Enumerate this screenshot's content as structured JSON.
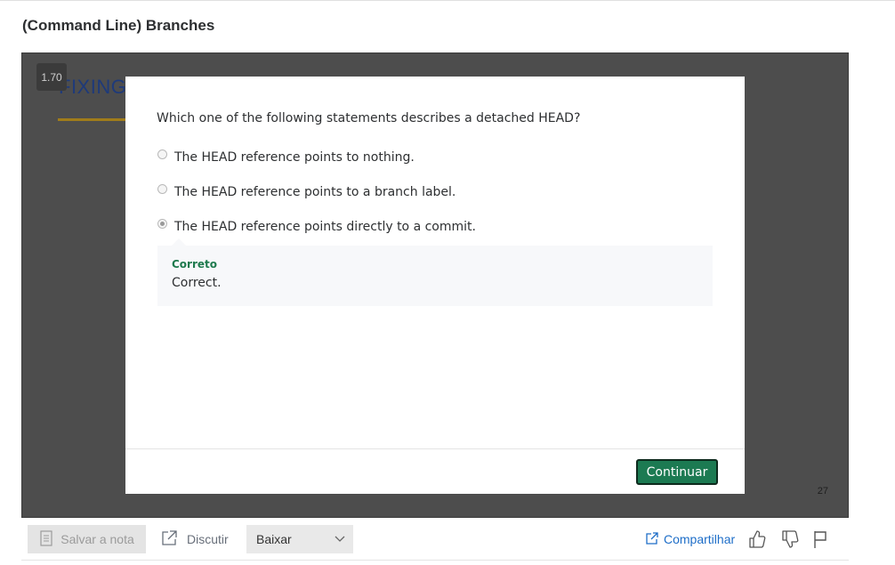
{
  "page": {
    "title": "(Command Line) Branches"
  },
  "video": {
    "speed": "1.70",
    "slide_text": "FIXING",
    "slide_counter": "27"
  },
  "quiz": {
    "question": "Which one of the following statements describes a detached HEAD?",
    "options": [
      {
        "label": "The HEAD reference points to nothing.",
        "selected": false
      },
      {
        "label": "The HEAD reference points to a branch label.",
        "selected": false
      },
      {
        "label": "The HEAD reference points directly to a commit.",
        "selected": true
      }
    ],
    "feedback": {
      "title": "Correto",
      "text": "Correct."
    },
    "continue_label": "Continuar"
  },
  "toolbar": {
    "save_note_label": "Salvar a nota",
    "discuss_label": "Discutir",
    "download_label": "Baixar",
    "share_label": "Compartilhar"
  },
  "colors": {
    "accent_green": "#1c7a52",
    "feedback_green": "#1e7a4d",
    "link_blue": "#1e6ec8",
    "video_bg": "#4d4d4d"
  }
}
